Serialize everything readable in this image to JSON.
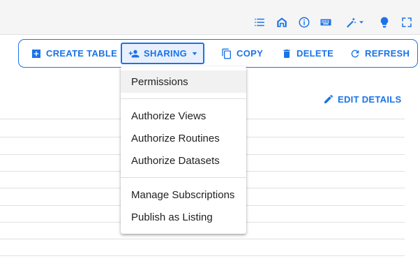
{
  "topbar": {
    "icons": [
      "list-icon",
      "home-icon",
      "info-icon",
      "keyboard-icon",
      "magic-wand-icon",
      "lightbulb-icon",
      "fullscreen-icon"
    ]
  },
  "toolbar": {
    "create_table": "CREATE TABLE",
    "sharing": "SHARING",
    "copy": "COPY",
    "delete": "DELETE",
    "refresh": "REFRESH"
  },
  "details": {
    "edit_label": "EDIT DETAILS"
  },
  "sharing_menu": {
    "items": [
      "Permissions",
      "Authorize Views",
      "Authorize Routines",
      "Authorize Datasets",
      "Manage Subscriptions",
      "Publish as Listing"
    ]
  },
  "colors": {
    "accent": "#1a73e8",
    "topbar_bg": "#f5f5f5",
    "menu_hover": "#f1f1f1"
  }
}
